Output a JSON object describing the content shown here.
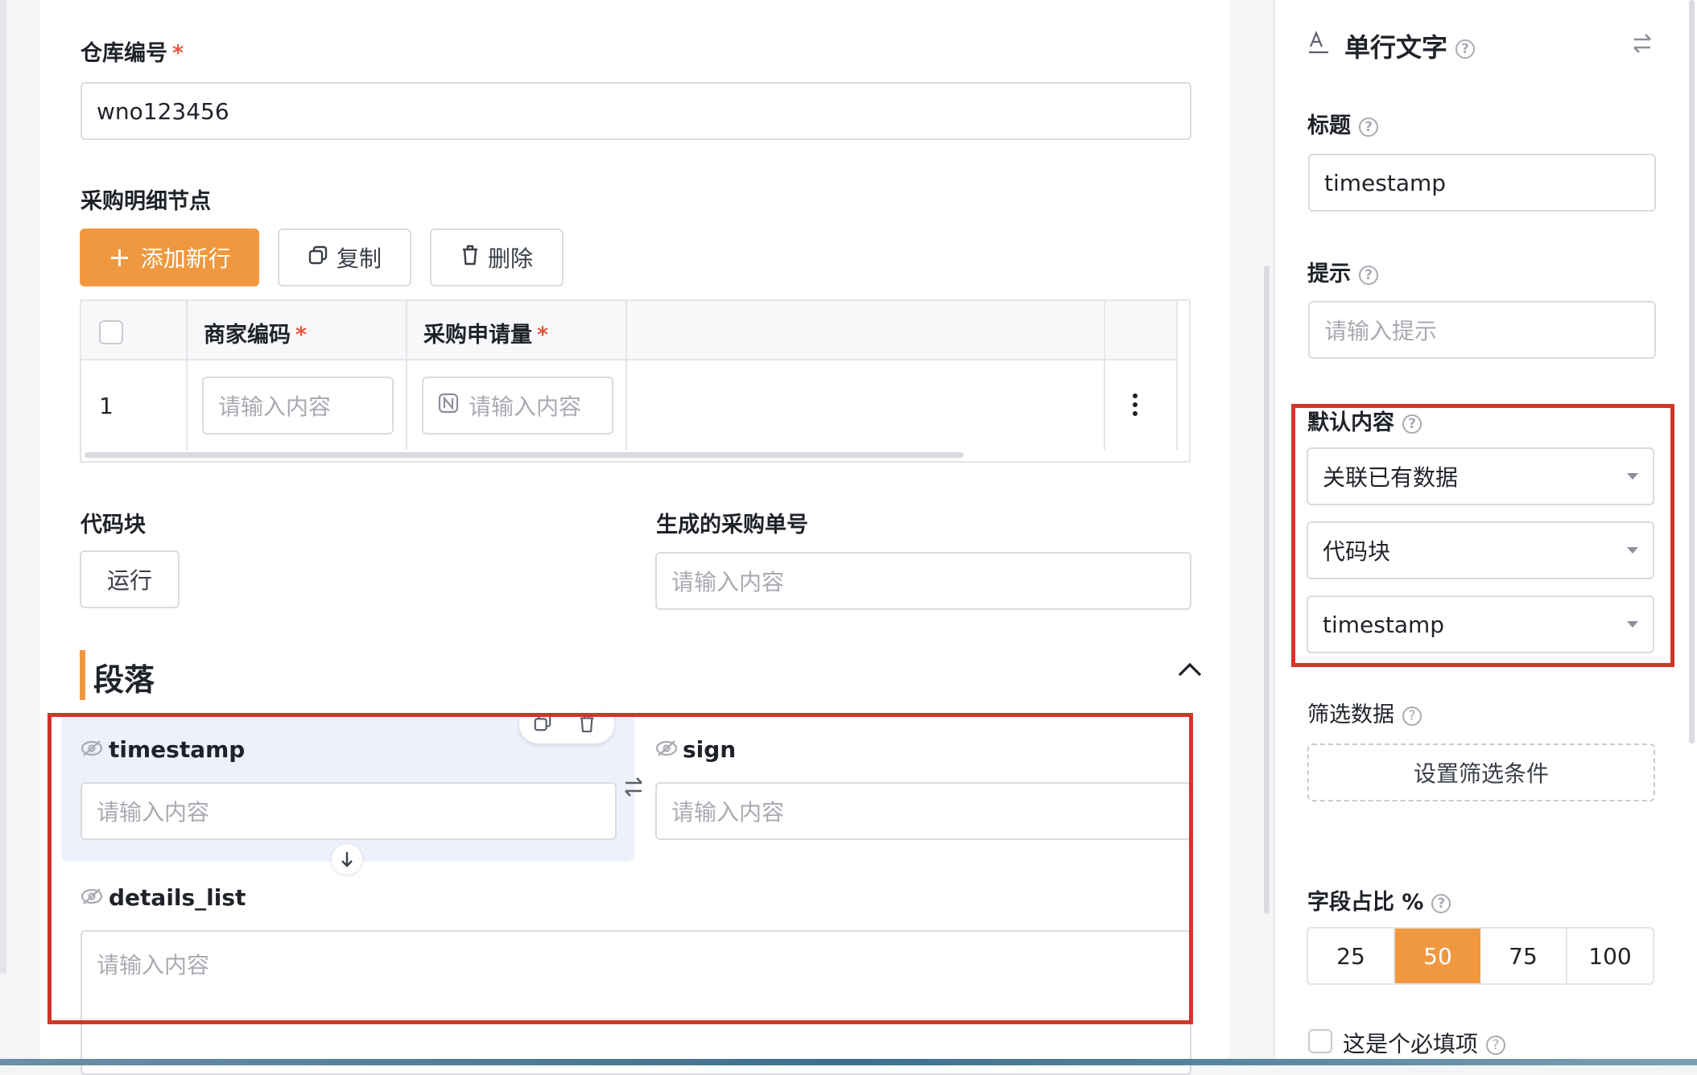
{
  "form": {
    "warehouse": {
      "label": "仓库编号",
      "required": "*",
      "value": "wno123456"
    },
    "purchase_details": {
      "label": "采购明细节点",
      "add_row": "添加新行",
      "copy": "复制",
      "delete": "删除",
      "columns": [
        {
          "label": "商家编码",
          "required": "*"
        },
        {
          "label": "采购申请量",
          "required": "*"
        }
      ],
      "rows": [
        {
          "index": "1",
          "merchant_code_placeholder": "请输入内容",
          "quantity_placeholder": "请输入内容"
        }
      ],
      "more_icon": "more-vertical-icon"
    },
    "code_block": {
      "label": "代码块",
      "run": "运行"
    },
    "generated_order": {
      "label": "生成的采购单号",
      "placeholder": "请输入内容"
    },
    "section": {
      "title": "段落",
      "fields": [
        {
          "name": "timestamp",
          "placeholder": "请输入内容"
        },
        {
          "name": "sign",
          "placeholder": "请输入内容"
        },
        {
          "name": "details_list",
          "placeholder": "请输入内容"
        }
      ]
    }
  },
  "panel": {
    "header_title": "单行文字",
    "title": {
      "label": "标题",
      "value": "timestamp"
    },
    "hint": {
      "label": "提示",
      "placeholder": "请输入提示"
    },
    "default_content": {
      "label": "默认内容",
      "selects": [
        "关联已有数据",
        "代码块",
        "timestamp"
      ]
    },
    "filter": {
      "label": "筛选数据",
      "button": "设置筛选条件"
    },
    "ratio": {
      "label": "字段占比 %",
      "options": [
        "25",
        "50",
        "75",
        "100"
      ],
      "selected": "50"
    },
    "required": {
      "label": "这是个必填项"
    }
  },
  "colors": {
    "accent": "#f0983f",
    "highlight_box": "#d0352b",
    "selected_field_bg": "#eef1fb"
  }
}
